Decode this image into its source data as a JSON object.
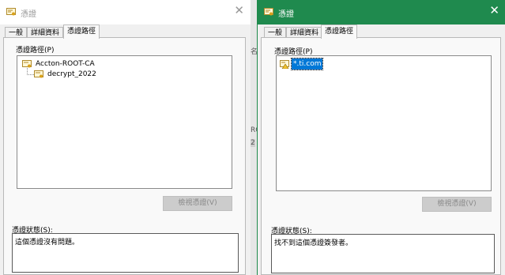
{
  "left_dialog": {
    "title": "憑證",
    "tabs": [
      {
        "label": "一般"
      },
      {
        "label": "詳細資料"
      },
      {
        "label": "憑證路徑"
      }
    ],
    "path_label": "憑證路徑(P)",
    "tree": [
      {
        "label": "Accton-ROOT-CA"
      },
      {
        "label": "decrypt_2022"
      }
    ],
    "view_button": "檢視憑證(V)",
    "status_label": "憑證狀態(S):",
    "status_text": "這個憑證沒有問題。"
  },
  "right_dialog": {
    "title": "憑證",
    "tabs": [
      {
        "label": "一般"
      },
      {
        "label": "詳細資料"
      },
      {
        "label": "憑證路徑"
      }
    ],
    "path_label": "憑證路徑(P)",
    "tree": [
      {
        "label": "*.ti.com"
      }
    ],
    "view_button": "檢視憑證(V)",
    "status_label": "憑證狀態(S):",
    "status_text": "找不到這個憑證簽發者。"
  },
  "background": {
    "fragments": [
      "名",
      "RO",
      "2"
    ]
  }
}
